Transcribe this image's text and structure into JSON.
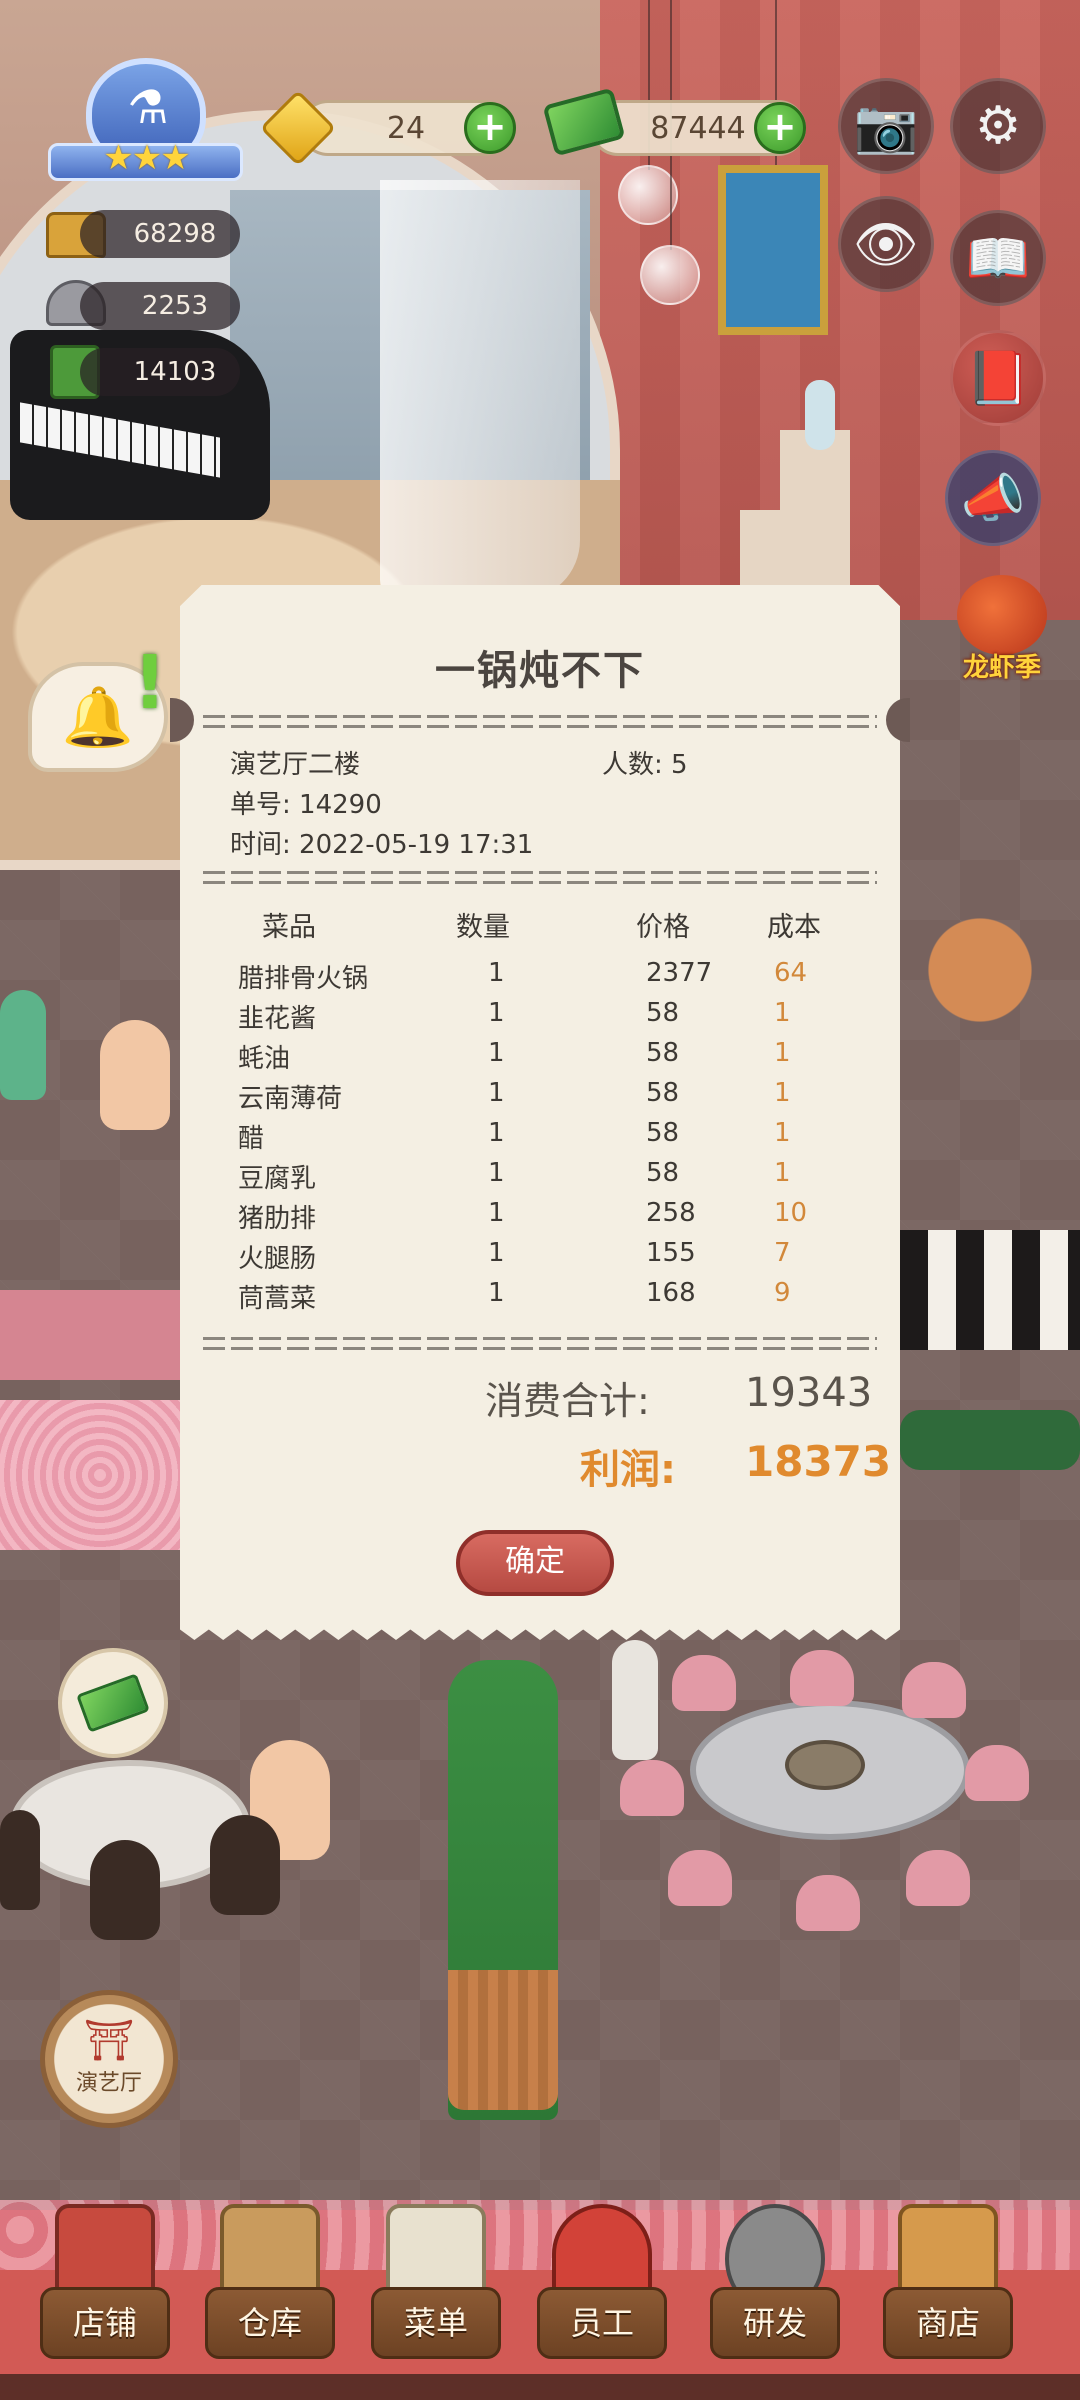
{
  "hud": {
    "stars": "★★★",
    "stats": [
      {
        "icon": "chef-hat-icon",
        "value": "68298"
      },
      {
        "icon": "dish-cloche-icon",
        "value": "2253"
      },
      {
        "icon": "recipe-book-icon",
        "value": "14103"
      }
    ],
    "gems": "24",
    "cash": "87444",
    "plus": "+",
    "side_icons": {
      "camera": "📷",
      "settings": "⚙",
      "eye": "👁",
      "help_book": "📖",
      "recipe": "📕",
      "announce": "📣"
    },
    "event_label": "龙虾季",
    "bell": "🔔",
    "exclaim": "!"
  },
  "receipt": {
    "title": "一锅炖不下",
    "location": "演艺厅二楼",
    "people_label": "人数",
    "people_sep": ":",
    "people_value": "5",
    "order_label": "单号",
    "order_sep": ":",
    "order_value": "14290",
    "time_label": "时间",
    "time_sep": ":",
    "time_value": "2022-05-19 17:31",
    "columns": {
      "dish": "菜品",
      "qty": "数量",
      "price": "价格",
      "cost": "成本"
    },
    "items": [
      {
        "dish": "腊排骨火锅",
        "qty": "1",
        "price": "2377",
        "cost": "64"
      },
      {
        "dish": "韭花酱",
        "qty": "1",
        "price": "58",
        "cost": "1"
      },
      {
        "dish": "蚝油",
        "qty": "1",
        "price": "58",
        "cost": "1"
      },
      {
        "dish": "云南薄荷",
        "qty": "1",
        "price": "58",
        "cost": "1"
      },
      {
        "dish": "醋",
        "qty": "1",
        "price": "58",
        "cost": "1"
      },
      {
        "dish": "豆腐乳",
        "qty": "1",
        "price": "58",
        "cost": "1"
      },
      {
        "dish": "猪肋排",
        "qty": "1",
        "price": "258",
        "cost": "10"
      },
      {
        "dish": "火腿肠",
        "qty": "1",
        "price": "155",
        "cost": "7"
      },
      {
        "dish": "茼蒿菜",
        "qty": "1",
        "price": "168",
        "cost": "9"
      }
    ],
    "total_label": "消费合计:",
    "total_value": "19343",
    "profit_label": "利润:",
    "profit_value": "18373",
    "confirm_label": "确定"
  },
  "hall_button": {
    "icon": "⛩",
    "label": "演艺厅"
  },
  "nav": [
    {
      "label": "店铺",
      "icon": "shop-building-icon",
      "color": "#c74a3e"
    },
    {
      "label": "仓库",
      "icon": "storage-boxes-icon",
      "color": "#c99b5d"
    },
    {
      "label": "菜单",
      "icon": "menu-clipboard-icon",
      "color": "#e8e1cf"
    },
    {
      "label": "员工",
      "icon": "staff-chef-icon",
      "color": "#d24238"
    },
    {
      "label": "研发",
      "icon": "research-pot-icon",
      "color": "#8a8a8a"
    },
    {
      "label": "商店",
      "icon": "store-stall-icon",
      "color": "#d69a4c"
    }
  ]
}
